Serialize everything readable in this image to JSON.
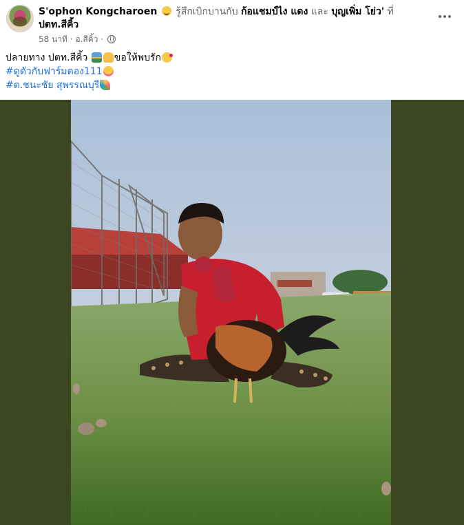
{
  "post": {
    "author": "S'ophon Kongcharoen",
    "feeling_prefix": "รู้สึกเบิกบานกับ",
    "tagged_1": "ก้อแชมป์ไง แดง",
    "conjunction": "และ",
    "tagged_2": "บุญเพิ่ม โย่ว'",
    "at": "ที่",
    "location": "ปตท.สีคิ้ว",
    "time": "58 นาที",
    "separator": "·",
    "place_short": "อ.สีคิ้ว",
    "text_line1": "ปลายทาง ปตท.สีคิ้ว",
    "text_line1_tail": "ขอให้พบรัก",
    "hashtag_1": "#ดูตัวกับฟาร์มตอง111",
    "hashtag_2": "#ต.ชนะชัย สุพรรณบุรี",
    "icons": {
      "avatar": "profile-avatar",
      "feeling": "relieved-face-emoji",
      "privacy": "globe-icon",
      "more": "more-options-icon"
    }
  },
  "colors": {
    "link": "#216fdb",
    "muted": "#65676b",
    "media_background": "#3c4722"
  }
}
